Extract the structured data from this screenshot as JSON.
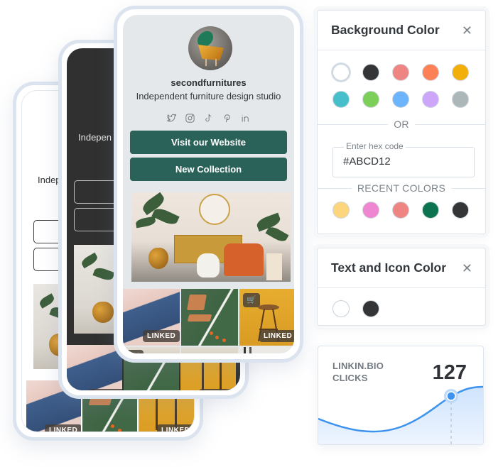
{
  "profile": {
    "username": "secondfurnitures",
    "bio": "Independent furniture design studio",
    "bio_truncated_mid": "Indepen",
    "bio_truncated_back": "Indep",
    "socials": [
      {
        "icon": "twitter-icon"
      },
      {
        "icon": "instagram-icon"
      },
      {
        "icon": "tiktok-icon"
      },
      {
        "icon": "pinterest-icon"
      },
      {
        "icon": "linkedin-icon"
      }
    ],
    "links": [
      {
        "label": "Visit our Website"
      },
      {
        "label": "New Collection"
      }
    ],
    "link_button_color": "#2a625a",
    "grid_badges": {
      "linked": "LINKED",
      "cart_icon": "cart-icon"
    }
  },
  "background_color_panel": {
    "title": "Background Color",
    "close_icon": "close-icon",
    "swatches": [
      "#ffffff",
      "#343537",
      "#ee8582",
      "#fd8156",
      "#f2ae09",
      "#46bfcb",
      "#7cd05a",
      "#6cb4fb",
      "#cda6fb",
      "#acb7b9"
    ],
    "selected_swatch": "#ffffff",
    "or_label": "OR",
    "hex_field": {
      "label": "Enter hex code",
      "value": "#ABCD12"
    },
    "recent_label": "RECENT COLORS",
    "recent_swatches": [
      "#fdd57c",
      "#ee86d1",
      "#ee8582",
      "#0b7350",
      "#343537"
    ]
  },
  "text_icon_color_panel": {
    "title": "Text and Icon Color",
    "close_icon": "close-icon",
    "swatches": [
      "#ffffff",
      "#343537"
    ]
  },
  "stats": {
    "label_line1": "LINKIN.BIO",
    "label_line2": "CLICKS",
    "value": "127",
    "accent": "#3d93ee"
  }
}
